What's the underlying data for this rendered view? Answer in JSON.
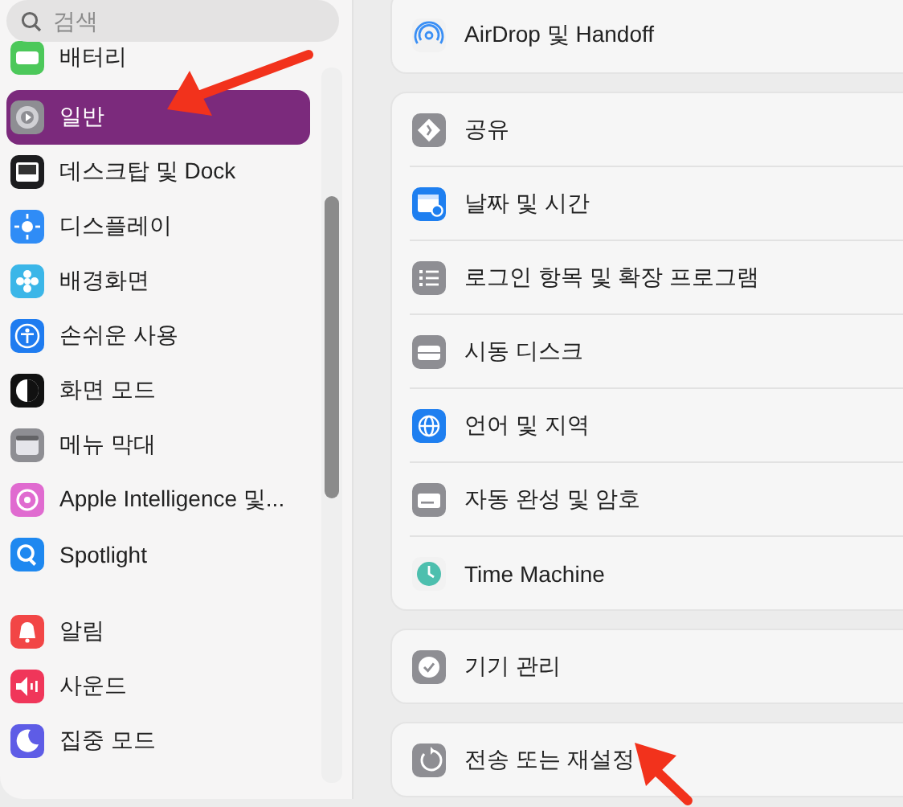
{
  "sidebar": {
    "search": {
      "placeholder": "검색"
    },
    "sections": [
      {
        "items": [
          {
            "label": "배터리",
            "selected": false
          }
        ]
      },
      {
        "items": [
          {
            "label": "일반",
            "selected": true
          },
          {
            "label": "데스크탑 및 Dock",
            "selected": false
          },
          {
            "label": "디스플레이",
            "selected": false
          },
          {
            "label": "배경화면",
            "selected": false
          },
          {
            "label": "손쉬운 사용",
            "selected": false
          },
          {
            "label": "화면 모드",
            "selected": false
          },
          {
            "label": "메뉴 막대",
            "selected": false
          },
          {
            "label": "Apple Intelligence 및...",
            "selected": false
          },
          {
            "label": "Spotlight",
            "selected": false
          }
        ]
      },
      {
        "items": [
          {
            "label": "알림",
            "selected": false
          },
          {
            "label": "사운드",
            "selected": false
          },
          {
            "label": "집중 모드",
            "selected": false
          }
        ]
      }
    ]
  },
  "main": {
    "groups": [
      {
        "rows": [
          {
            "label": "AirDrop 및 Handoff"
          }
        ]
      },
      {
        "rows": [
          {
            "label": "공유"
          },
          {
            "label": "날짜 및 시간"
          },
          {
            "label": "로그인 항목 및 확장 프로그램"
          },
          {
            "label": "시동 디스크"
          },
          {
            "label": "언어 및 지역"
          },
          {
            "label": "자동 완성 및 암호"
          },
          {
            "label": "Time Machine"
          }
        ]
      },
      {
        "rows": [
          {
            "label": "기기 관리"
          }
        ]
      },
      {
        "rows": [
          {
            "label": "전송 또는 재설정"
          }
        ]
      }
    ]
  },
  "annotations": [
    {
      "kind": "arrow"
    },
    {
      "kind": "arrow"
    }
  ]
}
